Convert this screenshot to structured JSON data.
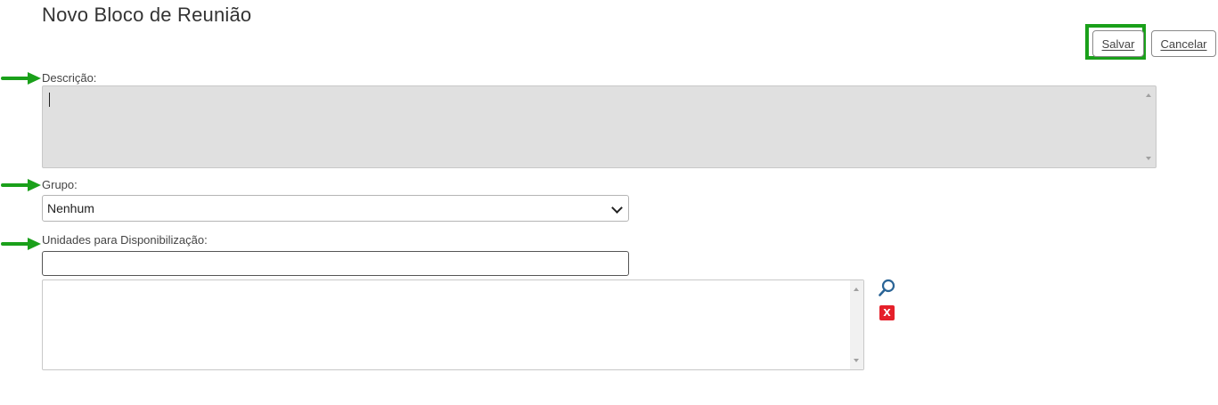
{
  "page": {
    "title": "Novo Bloco de Reunião"
  },
  "toolbar": {
    "save_label": "Salvar",
    "cancel_label": "Cancelar"
  },
  "form": {
    "description_label": "Descrição:",
    "description_value": "",
    "group_label": "Grupo:",
    "group_selected": "Nenhum",
    "units_label": "Unidades para Disponibilização:",
    "units_input_value": "",
    "units_list": []
  },
  "icons": {
    "search": "search-icon",
    "remove": "remove-icon",
    "remove_glyph": "X",
    "annotation_arrow": "green-arrow-icon"
  },
  "colors": {
    "highlight": "#1aa01a",
    "remove": "#e5202a",
    "search": "#2a6496",
    "textarea_bg": "#e0e0e0"
  }
}
